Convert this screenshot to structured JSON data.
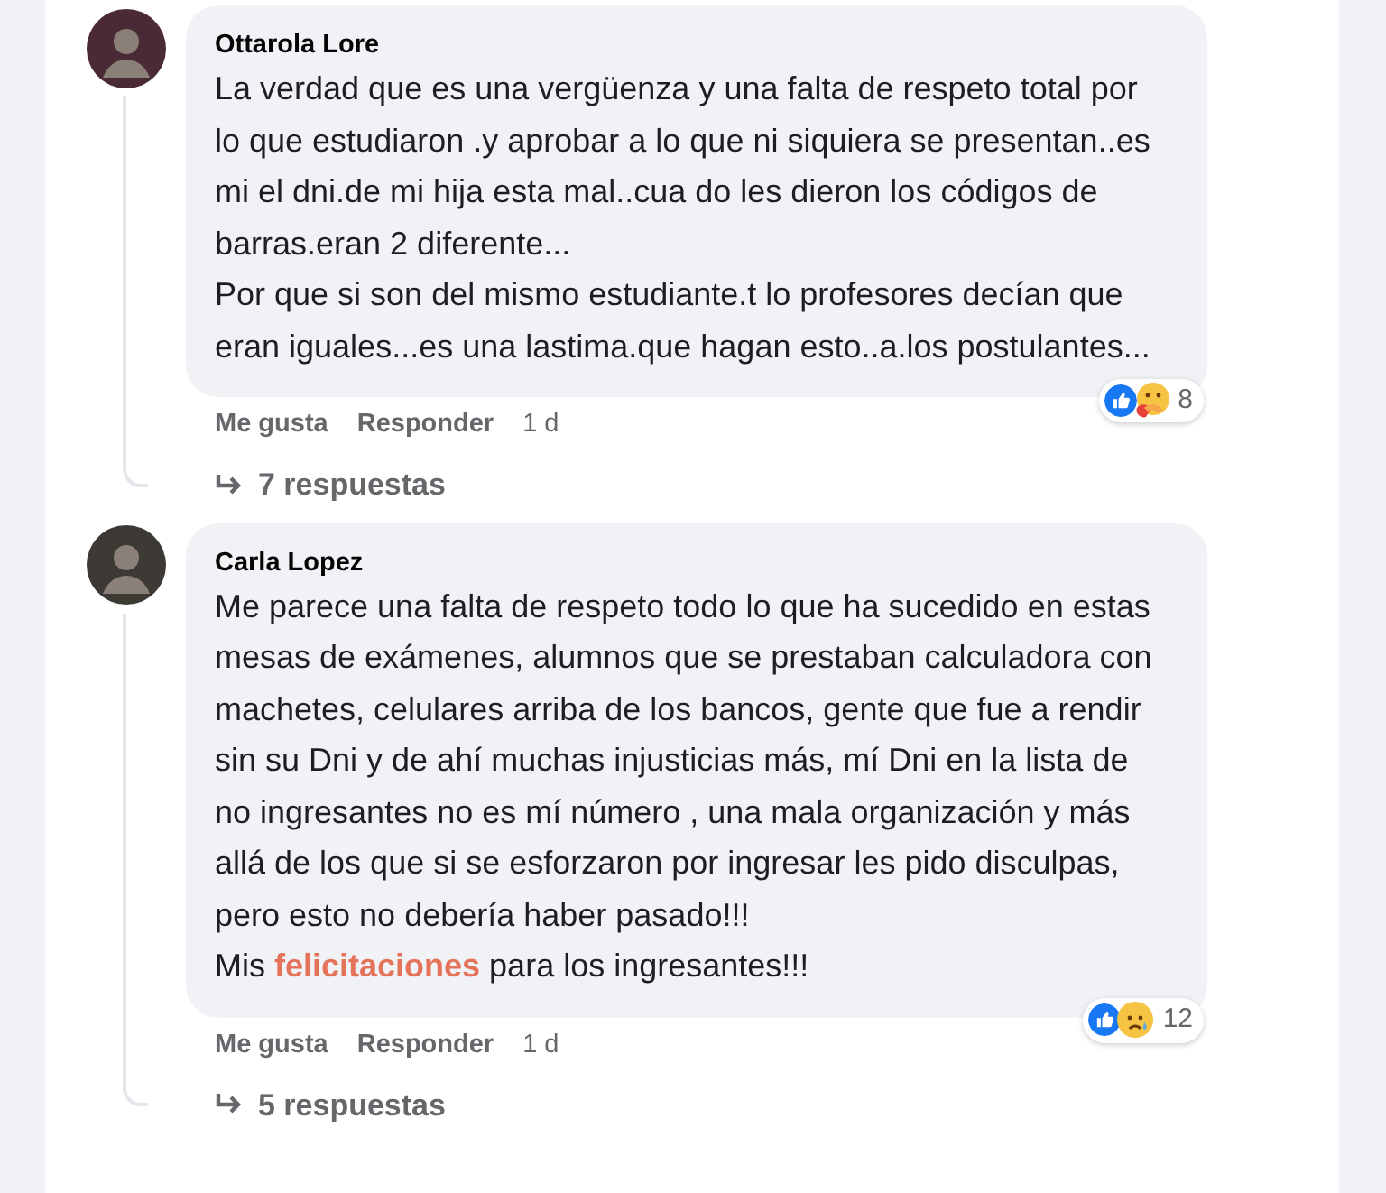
{
  "comments": [
    {
      "author": "Ottarola Lore",
      "paragraphs": [
        "La verdad que es una vergüenza y una falta de respeto total por lo que estudiaron .y aprobar a lo que ni siquiera se presentan..es mi el dni.de mi hija esta mal..cua do les dieron los códigos de barras.eran 2 diferente...",
        "Por que si son del mismo estudiante.t lo profesores decían que eran iguales...es una lastima.que hagan esto..a.los postulantes..."
      ],
      "reactions": [
        {
          "kind": "like"
        },
        {
          "kind": "care"
        }
      ],
      "reaction_count": "8",
      "actions": [
        "Me gusta",
        "Responder"
      ],
      "time": "1 d",
      "replies": "7 respuestas"
    },
    {
      "author": "Carla Lopez",
      "paragraphs": [
        "Me parece una falta de respeto todo lo que ha sucedido en estas mesas de exámenes, alumnos que se prestaban calculadora con machetes, celulares arriba de los bancos, gente que fue a rendir sin su Dni y de ahí muchas injusticias más, mí Dni en la lista de no ingresantes no es mí número , una mala organización y más allá de los que si se esforzaron por ingresar les pido disculpas, pero esto no debería haber pasado!!!",
        "Mis **felicitaciones** para los ingresantes!!!"
      ],
      "reactions": [
        {
          "kind": "like"
        },
        {
          "kind": "sad"
        }
      ],
      "reaction_count": "12",
      "actions": [
        "Me gusta",
        "Responder"
      ],
      "time": "1 d",
      "replies": "5 respuestas"
    }
  ]
}
